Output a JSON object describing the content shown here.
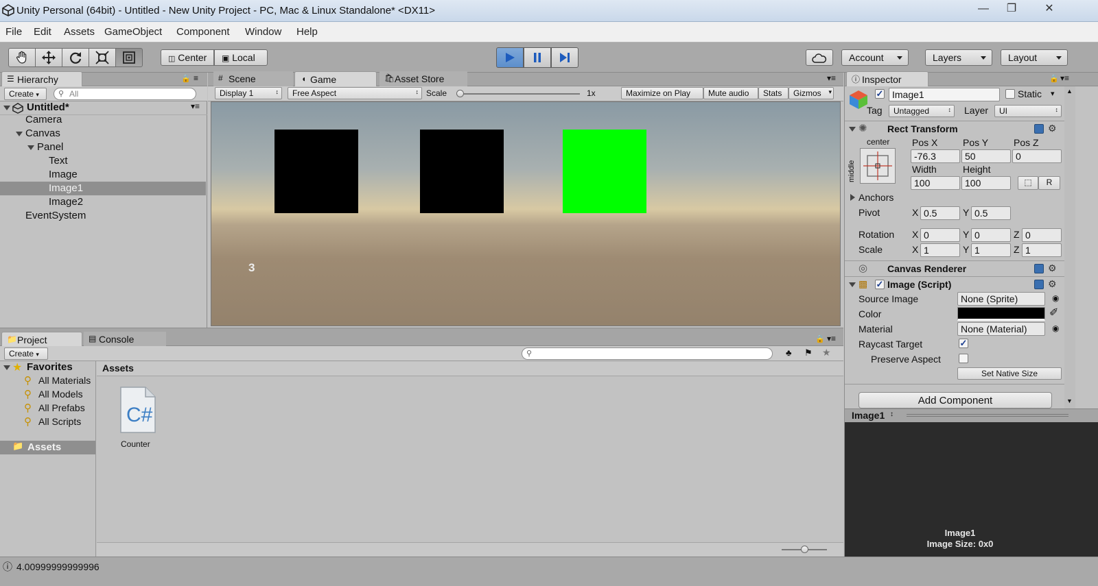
{
  "window": {
    "title": "Unity Personal (64bit) - Untitled - New Unity Project - PC, Mac & Linux Standalone* <DX11>",
    "minimize": "—",
    "maximize": "❐",
    "close": "✕"
  },
  "menu": [
    "File",
    "Edit",
    "Assets",
    "GameObject",
    "Component",
    "Window",
    "Help"
  ],
  "toolbar": {
    "center_label": "Center",
    "local_label": "Local",
    "account_label": "Account",
    "layers_label": "Layers",
    "layout_label": "Layout",
    "play_active": true
  },
  "hierarchy": {
    "tab_label": "Hierarchy",
    "create_label": "Create",
    "search_placeholder": "All",
    "scene_name": "Untitled*",
    "items": [
      {
        "label": "Camera",
        "depth": 1
      },
      {
        "label": "Canvas",
        "depth": 1,
        "expanded": true
      },
      {
        "label": "Panel",
        "depth": 2,
        "expanded": true
      },
      {
        "label": "Text",
        "depth": 3
      },
      {
        "label": "Image",
        "depth": 3
      },
      {
        "label": "Image1",
        "depth": 3,
        "selected": true
      },
      {
        "label": "Image2",
        "depth": 3
      },
      {
        "label": "EventSystem",
        "depth": 1
      }
    ]
  },
  "center_tabs": {
    "scene": "Scene",
    "game": "Game",
    "asset_store": "Asset Store"
  },
  "game_view": {
    "display": "Display 1",
    "aspect": "Free Aspect",
    "scale_label": "Scale",
    "scale_value": "1x",
    "scale_fraction": 0,
    "maximize_on_play": "Maximize on Play",
    "mute_audio": "Mute audio",
    "stats": "Stats",
    "gizmos": "Gizmos",
    "counter_text": "3",
    "squares": [
      {
        "name": "image",
        "color": "#000000"
      },
      {
        "name": "image1",
        "color": "#000000"
      },
      {
        "name": "image2",
        "color": "#00ff00"
      }
    ]
  },
  "project": {
    "tab_project": "Project",
    "tab_console": "Console",
    "create_label": "Create",
    "favorites_label": "Favorites",
    "favorites": [
      "All Materials",
      "All Models",
      "All Prefabs",
      "All Scripts"
    ],
    "assets_folder": "Assets",
    "breadcrumb": "Assets",
    "files": [
      {
        "name": "Counter",
        "icon": "csharp-script-icon"
      }
    ],
    "zoom_fraction": 0.5
  },
  "inspector": {
    "tab_label": "Inspector",
    "object_name": "Image1",
    "active": true,
    "static_label": "Static",
    "tag_label": "Tag",
    "tag_value": "Untagged",
    "layer_label": "Layer",
    "layer_value": "UI",
    "rect_transform": {
      "title": "Rect Transform",
      "anchor_h": "center",
      "anchor_v": "middle",
      "pos_x_label": "Pos X",
      "pos_x": "-76.3",
      "pos_y_label": "Pos Y",
      "pos_y": "50",
      "pos_z_label": "Pos Z",
      "pos_z": "0",
      "width_label": "Width",
      "width": "100",
      "height_label": "Height",
      "height": "100",
      "r_label": "R",
      "anchors_label": "Anchors",
      "pivot_label": "Pivot",
      "pivot_x": "0.5",
      "pivot_y": "0.5",
      "rotation_label": "Rotation",
      "rot_x": "0",
      "rot_y": "0",
      "rot_z": "0",
      "scale_label": "Scale",
      "scale_x": "1",
      "scale_y": "1",
      "scale_z": "1",
      "x_label": "X",
      "y_label": "Y",
      "z_label": "Z"
    },
    "canvas_renderer": {
      "title": "Canvas Renderer"
    },
    "image_script": {
      "title": "Image (Script)",
      "enabled": true,
      "source_image_label": "Source Image",
      "source_image": "None (Sprite)",
      "color_label": "Color",
      "color": "#000000",
      "material_label": "Material",
      "material": "None (Material)",
      "raycast_label": "Raycast Target",
      "raycast": true,
      "preserve_label": "Preserve Aspect",
      "preserve": false,
      "set_native_size": "Set Native Size"
    },
    "add_component": "Add Component",
    "preview": {
      "header": "Image1",
      "line1": "Image1",
      "line2": "Image Size: 0x0"
    }
  },
  "status_bar": {
    "message": "4.00999999999996"
  }
}
